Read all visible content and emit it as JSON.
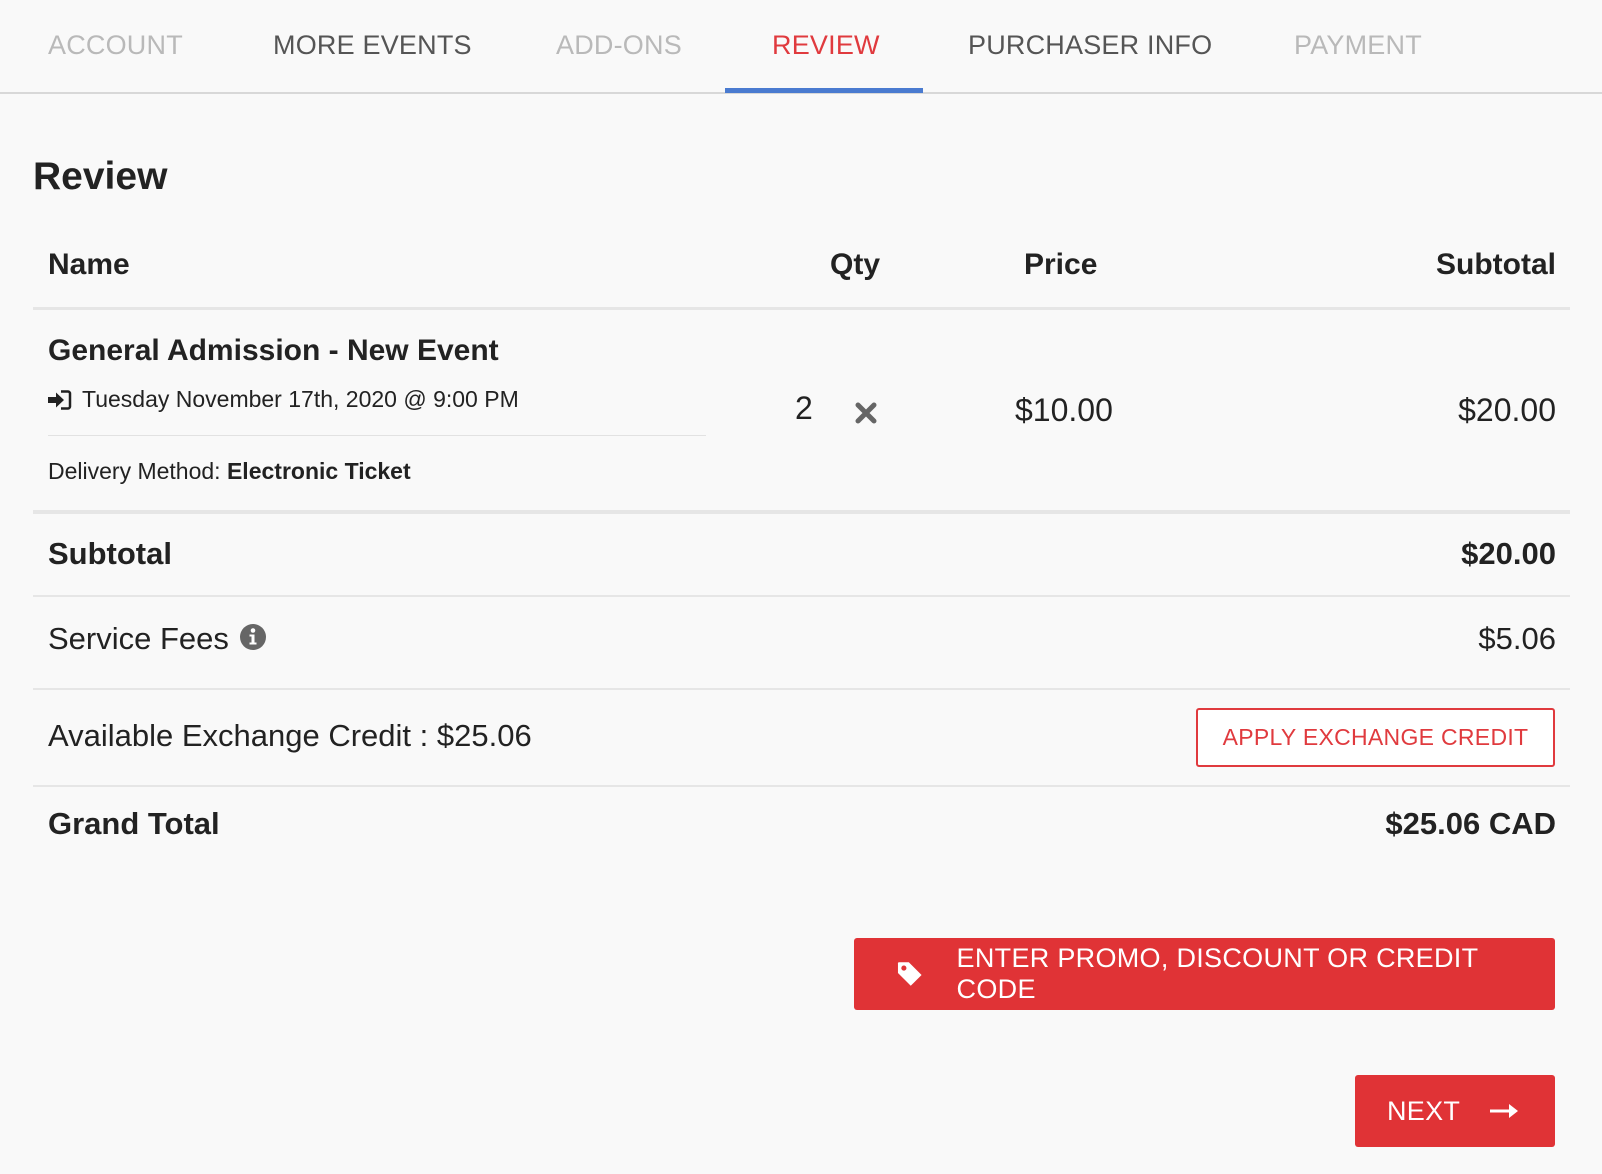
{
  "tabs": [
    {
      "label": "ACCOUNT",
      "state": "disabled"
    },
    {
      "label": "MORE EVENTS",
      "state": "normal"
    },
    {
      "label": "ADD-ONS",
      "state": "disabled"
    },
    {
      "label": "REVIEW",
      "state": "active"
    },
    {
      "label": "PURCHASER INFO",
      "state": "normal"
    },
    {
      "label": "PAYMENT",
      "state": "disabled"
    }
  ],
  "page": {
    "title": "Review"
  },
  "table": {
    "headers": {
      "name": "Name",
      "qty": "Qty",
      "price": "Price",
      "subtotal": "Subtotal"
    },
    "items": [
      {
        "name": "General Admission - New Event",
        "date": "Tuesday November 17th, 2020 @ 9:00 PM",
        "date_icon": "sign-in-icon",
        "delivery_label": "Delivery Method:",
        "delivery_value": "Electronic Ticket",
        "qty": "2",
        "price": "$10.00",
        "subtotal": "$20.00"
      }
    ]
  },
  "summary": {
    "subtotal_label": "Subtotal",
    "subtotal_value": "$20.00",
    "fees_label": "Service Fees",
    "fees_value": "$5.06",
    "credit_label": "Available Exchange Credit : $25.06",
    "apply_credit_button": "APPLY EXCHANGE CREDIT",
    "grand_total_label": "Grand Total",
    "grand_total_value": "$25.06 CAD"
  },
  "actions": {
    "promo_button": "ENTER PROMO, DISCOUNT OR CREDIT CODE",
    "next_button": "NEXT"
  },
  "colors": {
    "accent_red": "#e03336",
    "active_tab_underline": "#4a7bd0",
    "disabled_tab": "#b9b9b9"
  }
}
